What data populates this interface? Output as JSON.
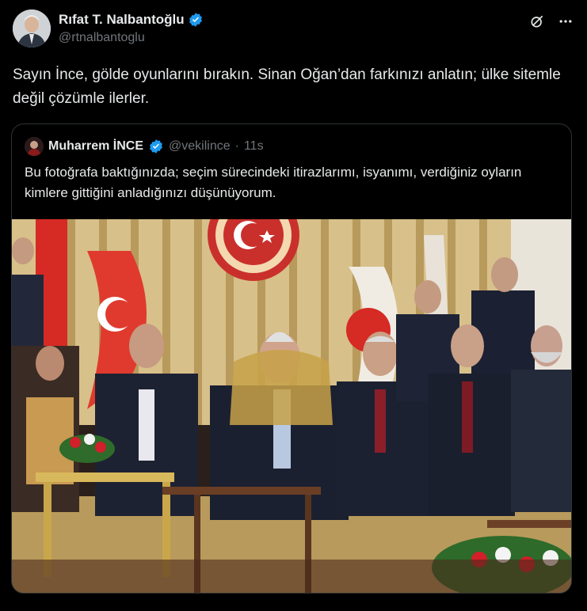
{
  "author": {
    "display_name": "Rıfat T. Nalbantoğlu",
    "handle": "@rtnalbantoglu",
    "verified_icon": "verified-badge-icon"
  },
  "header_actions": {
    "grok_icon": "grok-icon",
    "more_icon": "more-icon"
  },
  "tweet": {
    "text": "Sayın İnce, gölde oyunlarını bırakın. Sinan Oğan’dan farkınızı anlatın; ülke sitemle değil çözümle ilerler."
  },
  "quoted_tweet": {
    "display_name": "Muharrem İNCE",
    "handle": "@vekilince",
    "separator": "·",
    "time": "11s",
    "text": "Bu fotoğrafa baktığınızda; seçim sürecindeki itirazlarımı, isyanımı, verdiğiniz oyların kimlere gittiğini anladığınızı düşünüyorum.",
    "media": "group-photo"
  },
  "colors": {
    "background": "#000000",
    "text_primary": "#e7e9ea",
    "text_secondary": "#71767b",
    "border": "#2f3336",
    "verified_blue": "#1d9bf0"
  }
}
